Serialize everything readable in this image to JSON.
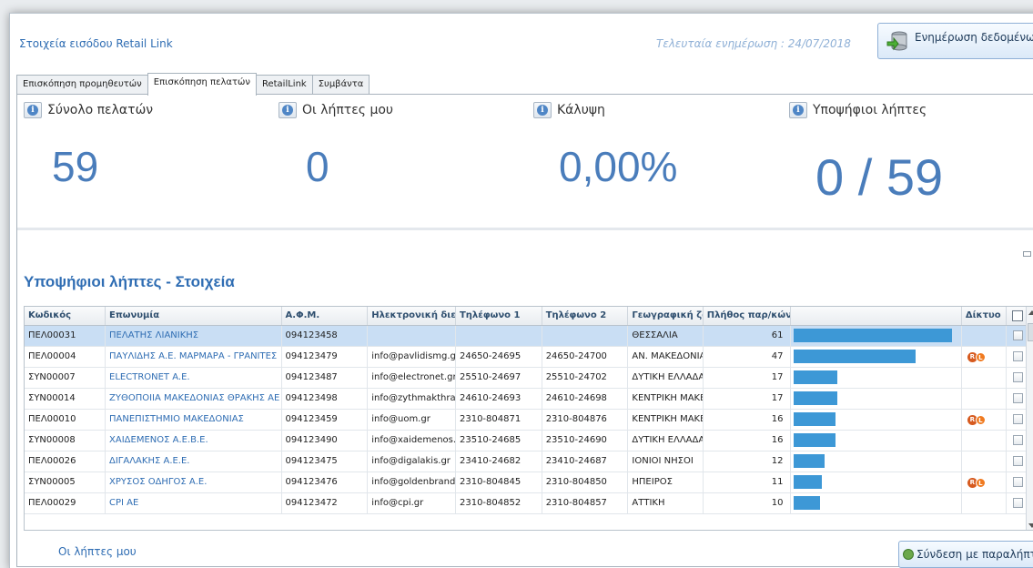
{
  "header": {
    "title": "Στοιχεία εισόδου Retail Link",
    "last_update": "Τελευταία ενημέρωση : 24/07/2018",
    "update_button_label": "Ενημέρωση δεδομένων"
  },
  "tabs": [
    {
      "label": "Επισκόπηση προμηθευτών",
      "active": false
    },
    {
      "label": "Επισκόπηση πελατών",
      "active": true
    },
    {
      "label": "RetailLink",
      "active": false
    },
    {
      "label": "Συμβάντα",
      "active": false
    }
  ],
  "kpis": {
    "total_customers": {
      "title": "Σύνολο πελατών",
      "value": "59"
    },
    "my_recipients": {
      "title": "Οι λήπτες μου",
      "value": "0"
    },
    "coverage": {
      "title": "Κάλυψη",
      "value": "0,00%"
    },
    "candidate_recipients": {
      "title": "Υποψήφιοι λήπτες",
      "value": "0 / 59"
    }
  },
  "section_title": "Υποψήφιοι λήπτες - Στοιχεία",
  "grid": {
    "columns": [
      "Κωδικός",
      "Επωνυμία",
      "Α.Φ.Μ.",
      "Ηλεκτρονική διεύθυνση",
      "Τηλέφωνο 1",
      "Τηλέφωνο 2",
      "Γεωγραφική ζώνη",
      "Πλήθος παρ/κών",
      "",
      "Δίκτυο",
      ""
    ],
    "max_count": 61,
    "rows": [
      {
        "code": "ΠΕΛ00031",
        "name": "ΠΕΛΑΤΗΣ ΛΙΑΝΙΚΗΣ",
        "afm": "094123458",
        "email": "",
        "phone1": "",
        "phone2": "",
        "zone": "ΘΕΣΣΑΛΙΑ",
        "count": 61,
        "network": false,
        "selected": true
      },
      {
        "code": "ΠΕΛ00004",
        "name": "ΠΑΥΛΙΔΗΣ Α.Ε. ΜΑΡΜΑΡΑ - ΓΡΑΝΙΤΕΣ",
        "afm": "094123479",
        "email": "info@pavlidismg.gr",
        "phone1": "24650-24695",
        "phone2": "24650-24700",
        "zone": "ΑΝ. ΜΑΚΕΔΟΝΙΑ-",
        "count": 47,
        "network": true,
        "selected": false
      },
      {
        "code": "ΣΥΝ00007",
        "name": "ELECTRONET A.E.",
        "afm": "094123487",
        "email": "info@electronet.gr",
        "phone1": "25510-24697",
        "phone2": "25510-24702",
        "zone": "ΔΥΤΙΚΗ ΕΛΛΑΔΑ",
        "count": 17,
        "network": false,
        "selected": false
      },
      {
        "code": "ΣΥΝ00014",
        "name": "ΖΥΘΟΠΟΙΙΑ ΜΑΚΕΔΟΝΙΑΣ ΘΡΑΚΗΣ ΑΕ",
        "afm": "094123498",
        "email": "info@zythmakthrakis.gr",
        "phone1": "24610-24693",
        "phone2": "24610-24698",
        "zone": "ΚΕΝΤΡΙΚΗ ΜΑΚΕΔ",
        "count": 17,
        "network": false,
        "selected": false
      },
      {
        "code": "ΠΕΛ00010",
        "name": "ΠΑΝΕΠΙΣΤΗΜΙΟ ΜΑΚΕΔΟΝΙΑΣ",
        "afm": "094123459",
        "email": "info@uom.gr",
        "phone1": "2310-804871",
        "phone2": "2310-804876",
        "zone": "ΚΕΝΤΡΙΚΗ ΜΑΚΕΔ",
        "count": 16,
        "network": true,
        "selected": false
      },
      {
        "code": "ΣΥΝ00008",
        "name": "ΧΑΙΔΕΜΕΝΟΣ Α.Ε.Β.Ε.",
        "afm": "094123490",
        "email": "info@xaidemenos.gr",
        "phone1": "23510-24685",
        "phone2": "23510-24690",
        "zone": "ΔΥΤΙΚΗ ΕΛΛΑΔΑ",
        "count": 16,
        "network": false,
        "selected": false
      },
      {
        "code": "ΠΕΛ00026",
        "name": "ΔΙΓΑΛΑΚΗΣ Α.Ε.Ε.",
        "afm": "094123475",
        "email": "info@digalakis.gr",
        "phone1": "23410-24682",
        "phone2": "23410-24687",
        "zone": "ΙΟΝΙΟΙ ΝΗΣΟΙ",
        "count": 12,
        "network": false,
        "selected": false
      },
      {
        "code": "ΣΥΝ00005",
        "name": "ΧΡΥΣΟΣ ΟΔΗΓΟΣ Α.Ε.",
        "afm": "094123476",
        "email": "info@goldenbrand.gr",
        "phone1": "2310-804845",
        "phone2": "2310-804850",
        "zone": "ΗΠΕΙΡΟΣ",
        "count": 11,
        "network": true,
        "selected": false
      },
      {
        "code": "ΠΕΛ00029",
        "name": "CPI AE",
        "afm": "094123472",
        "email": "info@cpi.gr",
        "phone1": "2310-804852",
        "phone2": "2310-804857",
        "zone": "ΑΤΤΙΚΗ",
        "count": 10,
        "network": false,
        "selected": false
      }
    ]
  },
  "footer": {
    "my_recipients_link": "Οι λήπτες μου",
    "connect_button_label": "Σύνδεση με παραλήπτη"
  },
  "icons": {
    "info": "info-icon",
    "database": "database-update-icon",
    "network": "retail-link-network-icon",
    "connect": "link-icon"
  },
  "colors": {
    "accent": "#2f6db3",
    "kpi_value": "#4a7dbb",
    "bar": "#3d98d6",
    "selected_row": "#c9def4"
  }
}
